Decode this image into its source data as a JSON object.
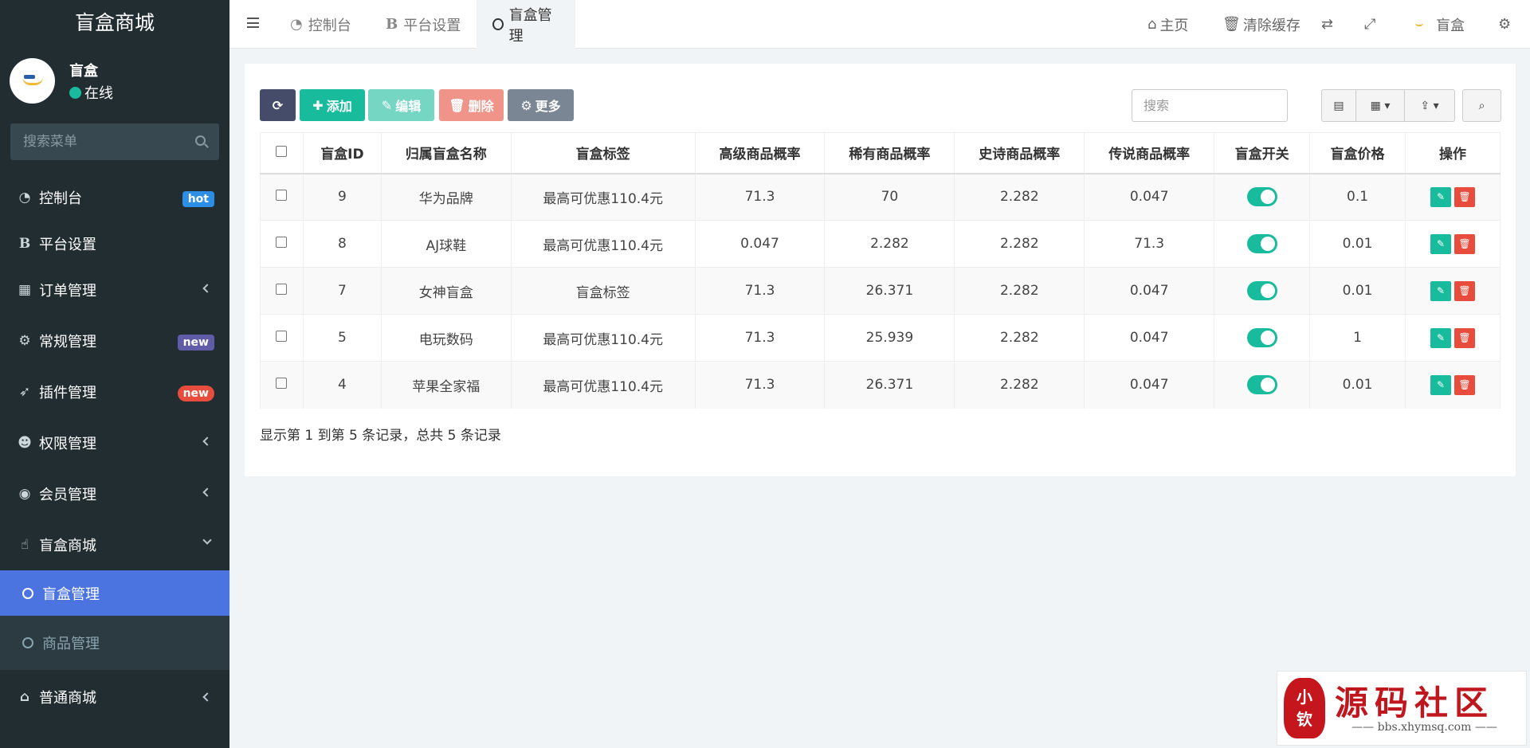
{
  "sidebar": {
    "brand": "盲盒商城",
    "user": {
      "name": "盲盒",
      "status": "在线"
    },
    "search_placeholder": "搜索菜单",
    "menu": [
      {
        "label": "控制台",
        "icon": "dashboard-icon",
        "badge": "hot"
      },
      {
        "label": "平台设置",
        "icon": "bold-b-icon"
      },
      {
        "label": "订单管理",
        "icon": "table-icon"
      },
      {
        "label": "常规管理",
        "icon": "cogs-icon",
        "badge": "new"
      },
      {
        "label": "插件管理",
        "icon": "rocket-icon",
        "badge": "new"
      },
      {
        "label": "权限管理",
        "icon": "group-icon"
      },
      {
        "label": "会员管理",
        "icon": "user-circle-icon"
      },
      {
        "label": "盲盒商城",
        "icon": "hand-icon"
      },
      {
        "label": "普通商城",
        "icon": "bank-icon"
      }
    ],
    "submenu": [
      {
        "label": "盲盒管理",
        "active": true
      },
      {
        "label": "商品管理",
        "active": false
      }
    ]
  },
  "topbar": {
    "tabs": [
      {
        "label": "控制台",
        "icon": "dashboard-icon"
      },
      {
        "label": "平台设置",
        "icon": "bold-b-icon"
      },
      {
        "label": "盲盒管理",
        "icon": "circle-icon",
        "active": true
      }
    ],
    "home": "主页",
    "clear_cache": "清除缓存",
    "user": "盲盒"
  },
  "toolbar": {
    "add": "添加",
    "edit": "编辑",
    "delete": "删除",
    "more": "更多",
    "search_placeholder": "搜索"
  },
  "table": {
    "columns": [
      "盲盒ID",
      "归属盲盒名称",
      "盲盒标签",
      "高级商品概率",
      "稀有商品概率",
      "史诗商品概率",
      "传说商品概率",
      "盲盒开关",
      "盲盒价格",
      "操作"
    ],
    "rows": [
      {
        "id": "9",
        "name": "华为品牌",
        "tag": "最高可优惠110.4元",
        "advanced": "71.3",
        "rare": "70",
        "epic": "2.282",
        "legend": "0.047",
        "switch": true,
        "price": "0.1"
      },
      {
        "id": "8",
        "name": "AJ球鞋",
        "tag": "最高可优惠110.4元",
        "advanced": "0.047",
        "rare": "2.282",
        "epic": "2.282",
        "legend": "71.3",
        "switch": true,
        "price": "0.01"
      },
      {
        "id": "7",
        "name": "女神盲盒",
        "tag": "盲盒标签",
        "advanced": "71.3",
        "rare": "26.371",
        "epic": "2.282",
        "legend": "0.047",
        "switch": true,
        "price": "0.01"
      },
      {
        "id": "5",
        "name": "电玩数码",
        "tag": "最高可优惠110.4元",
        "advanced": "71.3",
        "rare": "25.939",
        "epic": "2.282",
        "legend": "0.047",
        "switch": true,
        "price": "1"
      },
      {
        "id": "4",
        "name": "苹果全家福",
        "tag": "最高可优惠110.4元",
        "advanced": "71.3",
        "rare": "26.371",
        "epic": "2.282",
        "legend": "0.047",
        "switch": true,
        "price": "0.01"
      }
    ],
    "summary": "显示第 1 到第 5 条记录，总共 5 条记录"
  },
  "watermark": {
    "seal": "小",
    "seal2": "钦",
    "title": "源码社区",
    "url": "bbs.xhymsq.com"
  },
  "colors": {
    "sidebar_bg": "#222d32",
    "accent_green": "#18bc9c",
    "active_blue": "#4b74e0",
    "danger_red": "#e74c3c"
  }
}
